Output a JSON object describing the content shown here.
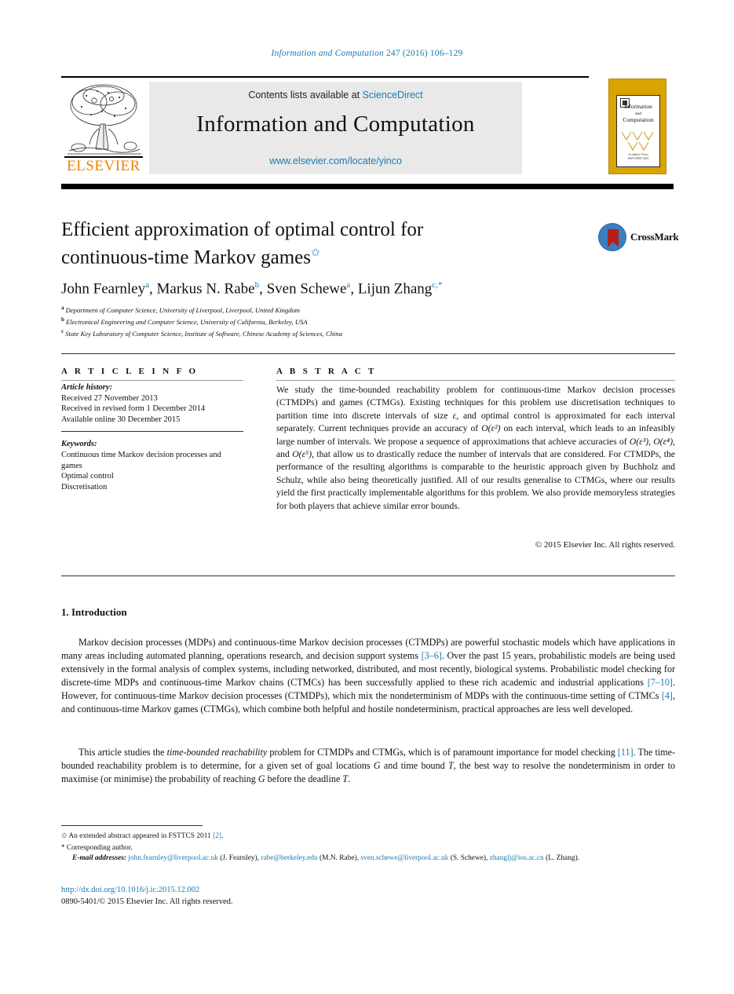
{
  "running_head": {
    "journal": "Information and Computation",
    "volume_issue": "247 (2016) 106–129"
  },
  "masthead": {
    "contents_prefix": "Contents lists available at ",
    "sciencedirect": "ScienceDirect",
    "journal_title": "Information and Computation",
    "journal_url": "www.elsevier.com/locate/yinco",
    "publisher_wordmark": "ELSEVIER",
    "cover": {
      "title_line1": "Information",
      "title_line2": "and",
      "title_line3": "Computation",
      "footer_line1": "Academic Press",
      "footer_line2": "ISSN 0890-5401"
    }
  },
  "article": {
    "title_line1": "Efficient approximation of optimal control for",
    "title_line2": "continuous-time Markov games",
    "title_footnote_marker": "✩",
    "crossmark_label": "CrossMark",
    "authors": [
      {
        "name": "John Fearnley",
        "marker": "a"
      },
      {
        "name": "Markus N. Rabe",
        "marker": "b"
      },
      {
        "name": "Sven Schewe",
        "marker": "a"
      },
      {
        "name": "Lijun Zhang",
        "marker": "c,*"
      }
    ],
    "affiliations": [
      {
        "marker": "a",
        "text": "Department of Computer Science, University of Liverpool, Liverpool, United Kingdom"
      },
      {
        "marker": "b",
        "text": "Electronical Engineering and Computer Science, University of California, Berkeley, USA"
      },
      {
        "marker": "c",
        "text": "State Key Laboratory of Computer Science, Institute of Software, Chinese Academy of Sciences, China"
      }
    ]
  },
  "article_info": {
    "heading": "A R T I C L E   I N F O",
    "history_label": "Article history:",
    "history": [
      "Received 27 November 2013",
      "Received in revised form 1 December 2014",
      "Available online 30 December 2015"
    ],
    "keywords_label": "Keywords:",
    "keywords": [
      "Continuous time Markov decision processes and games",
      "Optimal control",
      "Discretisation"
    ]
  },
  "abstract": {
    "heading": "A B S T R A C T",
    "text_part1": "We study the time-bounded reachability problem for continuous-time Markov decision processes (CTMDPs) and games (CTMGs). Existing techniques for this problem use discretisation techniques to partition time into discrete intervals of size ",
    "epsilon": "ε",
    "text_part2": ", and optimal control is approximated for each interval separately. Current techniques provide an accuracy of ",
    "accuracy_current": "O(ε²)",
    "text_part3": " on each interval, which leads to an infeasibly large number of intervals. We propose a sequence of approximations that achieve accuracies of ",
    "accuracy_a": "O(ε³)",
    "accuracy_b": "O(ε⁴)",
    "accuracy_c": "O(ε⁵)",
    "text_part4": ", that allow us to drastically reduce the number of intervals that are considered. For CTMDPs, the performance of the resulting algorithms is comparable to the heuristic approach given by Buchholz and Schulz, while also being theoretically justified. All of our results generalise to CTMGs, where our results yield the first practically implementable algorithms for this problem. We also provide memoryless strategies for both players that achieve similar error bounds.",
    "copyright": "© 2015 Elsevier Inc. All rights reserved."
  },
  "body": {
    "section_heading": "1. Introduction",
    "paragraph1": {
      "seg1": "Markov decision processes (MDPs) and continuous-time Markov decision processes (CTMDPs) are powerful stochastic models which have applications in many areas including automated planning, operations research, and decision support systems ",
      "ref1": "[3–6]",
      "seg2": ". Over the past 15 years, probabilistic models are being used extensively in the formal analysis of complex systems, including networked, distributed, and most recently, biological systems. Probabilistic model checking for discrete-time MDPs and continuous-time Markov chains (CTMCs) has been successfully applied to these rich academic and industrial applications ",
      "ref2": "[7–10]",
      "seg3": ". However, for continuous-time Markov decision processes (CTMDPs), which mix the nondeterminism of MDPs with the continuous-time setting of CTMCs ",
      "ref3": "[4]",
      "seg4": ", and continuous-time Markov games (CTMGs), which combine both helpful and hostile nondeterminism, practical approaches are less well developed."
    },
    "paragraph2": {
      "seg1": "This article studies the ",
      "emph": "time-bounded reachability",
      "seg2": " problem for CTMDPs and CTMGs, which is of paramount importance for model checking ",
      "ref1": "[11]",
      "seg3": ". The time-bounded reachability problem is to determine, for a given set of goal locations ",
      "math_g1": "G",
      "seg4": " and time bound ",
      "math_t1": "T",
      "seg5": ", the best way to resolve the nondeterminism in order to maximise (or minimise) the probability of reaching ",
      "math_g2": "G",
      "seg6": " before the deadline ",
      "math_t2": "T",
      "seg7": "."
    }
  },
  "footnotes": {
    "star_marker": "✩",
    "star_text_pre": "An extended abstract appeared in FSTTCS 2011 ",
    "star_ref": "[2]",
    "star_text_post": ".",
    "corresponding_marker": "*",
    "corresponding_text": "Corresponding author.",
    "email_label": "E-mail addresses:",
    "emails": [
      {
        "address": "john.fearnley@liverpool.ac.uk",
        "owner": "(J. Fearnley)"
      },
      {
        "address": "rabe@berkeley.edu",
        "owner": "(M.N. Rabe)"
      },
      {
        "address": "sven.schewe@liverpool.ac.uk",
        "owner": "(S. Schewe)"
      },
      {
        "address": "zhanglj@ios.ac.cn",
        "owner": "(L. Zhang)"
      }
    ],
    "doi": "http://dx.doi.org/10.1016/j.ic.2015.12.002",
    "issn_line": "0890-5401/© 2015 Elsevier Inc. All rights reserved."
  },
  "colors": {
    "link_blue": "#1a7bb0",
    "elsevier_orange": "#ef8200",
    "cover_gold": "#d9a400",
    "banner_gray": "#e9e9e9"
  }
}
